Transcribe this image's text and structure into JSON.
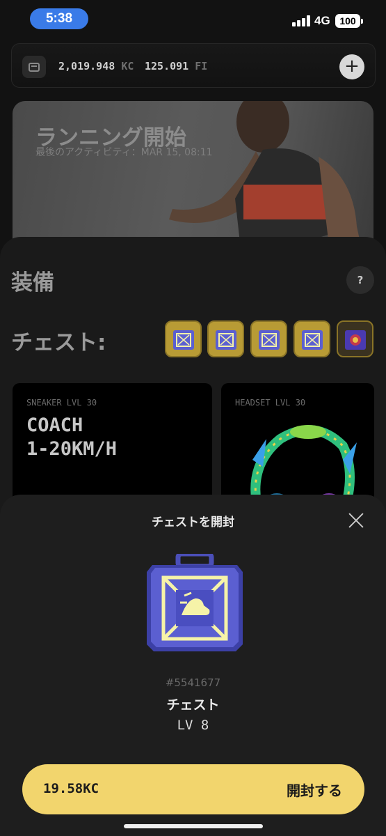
{
  "status_bar": {
    "time": "5:38",
    "network": "4G",
    "battery": "100"
  },
  "wallet": {
    "kc_amount": "2,019.948",
    "kc_unit": "KC",
    "fi_amount": "125.091",
    "fi_unit": "FI",
    "add_label": "+"
  },
  "run_banner": {
    "title": "ランニング開始",
    "subtitle": "最後のアクティビティ：MAR 15, 08:11"
  },
  "equipment": {
    "title": "装備",
    "help_label": "?",
    "chest_label": "チェスト:",
    "cards": [
      {
        "label": "SNEAKER LVL 30",
        "value": "COACH\n1-20KM/H"
      },
      {
        "label": "HEADSET LVL 30",
        "value": ""
      }
    ]
  },
  "modal": {
    "title": "チェストを開封",
    "chest_id": "#5541677",
    "chest_name": "チェスト",
    "chest_level": "LV 8",
    "price": "19.58KC",
    "open_label": "開封する"
  },
  "colors": {
    "accent": "#f2d56d",
    "time_pill": "#3a7be8",
    "chest_gold": "#b89b35",
    "chest_blue": "#5b5fd1"
  }
}
